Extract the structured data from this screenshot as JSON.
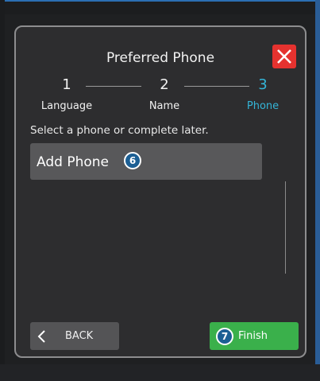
{
  "dialog": {
    "title": "Preferred Phone",
    "close_icon": "close-x-icon",
    "close_color": "#e5322f"
  },
  "steps": [
    {
      "number": "1",
      "label": "Language",
      "active": false
    },
    {
      "number": "2",
      "label": "Name",
      "active": false
    },
    {
      "number": "3",
      "label": "Phone",
      "active": true
    }
  ],
  "accent_color": "#34b5d8",
  "instruction": "Select a phone or complete later.",
  "list": {
    "items": [
      {
        "label": "Add Phone",
        "callout": "6"
      }
    ]
  },
  "buttons": {
    "back_label": "BACK",
    "back_icon": "chevron-left-icon",
    "finish_label": "Finish",
    "finish_callout": "7",
    "finish_color": "#3ab04b"
  }
}
